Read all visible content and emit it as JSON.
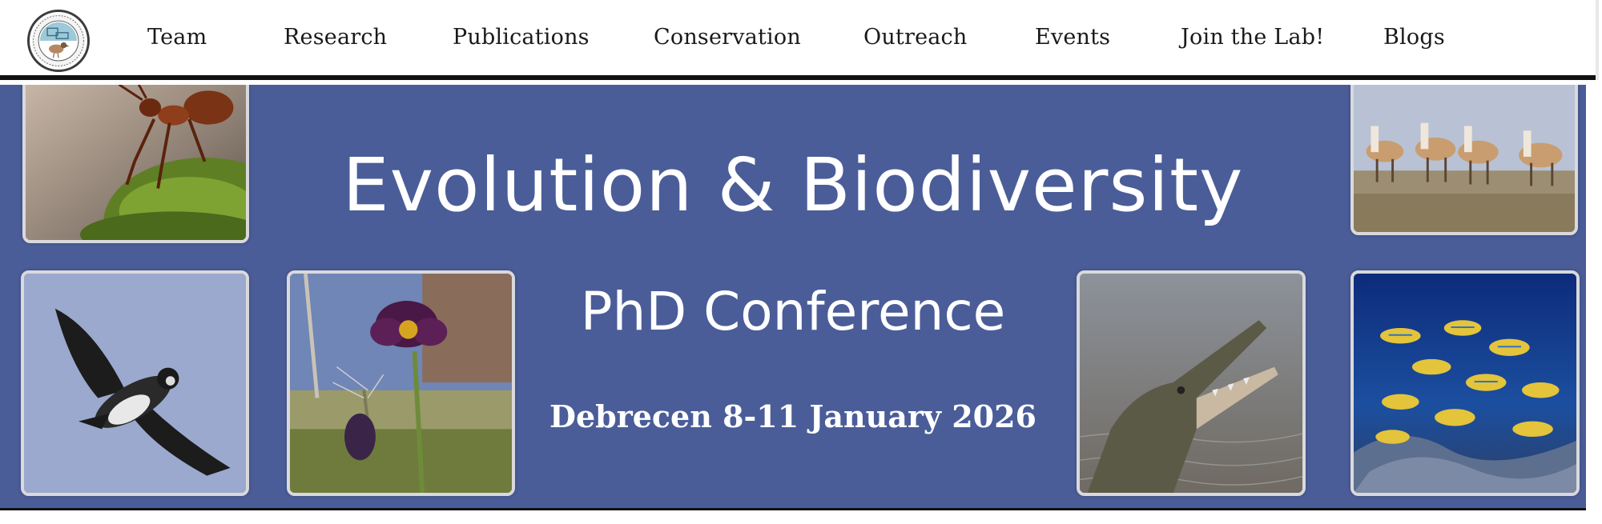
{
  "header": {
    "logo_alt": "Lab logo",
    "nav": [
      {
        "label": "Team",
        "name": "nav-team"
      },
      {
        "label": "Research",
        "name": "nav-research"
      },
      {
        "label": "Publications",
        "name": "nav-publications"
      },
      {
        "label": "Conservation",
        "name": "nav-conservation"
      },
      {
        "label": "Outreach",
        "name": "nav-outreach"
      },
      {
        "label": "Events",
        "name": "nav-events"
      },
      {
        "label": "Join the Lab!",
        "name": "nav-join-the-lab"
      },
      {
        "label": "Blogs",
        "name": "nav-blogs"
      }
    ]
  },
  "banner": {
    "title": "Evolution & Biodiversity",
    "subtitle": "PhD Conference",
    "date_line": "Debrecen 8-11 January 2026",
    "background_color": "#4a5d98",
    "photos": [
      {
        "name": "photo-ant",
        "subject": "ant on moss"
      },
      {
        "name": "photo-antelopes",
        "subject": "antelopes"
      },
      {
        "name": "photo-lapwing",
        "subject": "lapwing in flight"
      },
      {
        "name": "photo-pasqueflower",
        "subject": "pasque flower"
      },
      {
        "name": "photo-crocodile",
        "subject": "crocodile"
      },
      {
        "name": "photo-reef-fish",
        "subject": "reef fish school"
      }
    ]
  }
}
